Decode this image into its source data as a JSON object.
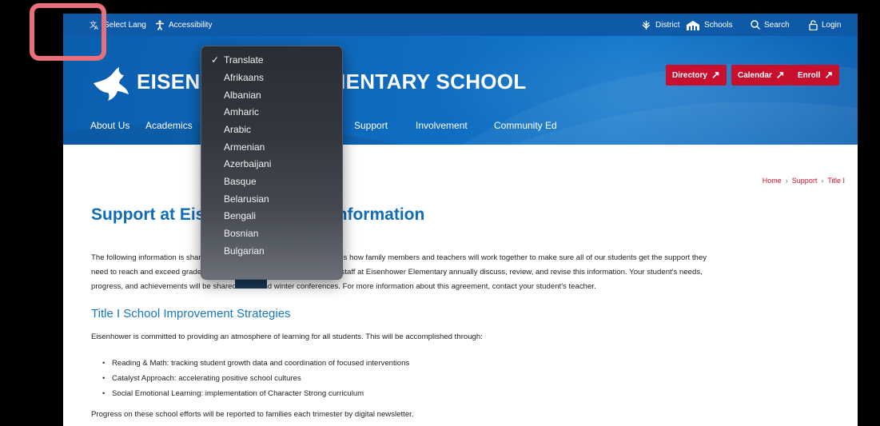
{
  "topbar": {
    "select_lang": "Select Lang",
    "accessibility": "Accessibility",
    "district": "District",
    "schools": "Schools",
    "search": "Search",
    "login": "Login"
  },
  "header": {
    "school_name": "EISENHOWER ELEMENTARY SCHOOL",
    "buttons": [
      "Directory",
      "Calendar",
      "Enroll"
    ],
    "nav": [
      "About Us",
      "Academics",
      "Support",
      "Involvement",
      "Community Ed"
    ]
  },
  "breadcrumb": [
    "Home",
    "Support",
    "Title I"
  ],
  "page_title": "Support at Eisenhower: Title I information",
  "intro_lines": [
    "The following information is shared in a school-family compact that explains how family members and teachers will work together to make sure all of our students get the support they",
    "need to reach and exceed grade-level standards. Families, students, and staff at Eisenhower Elementary annually discuss, review, and revise this information.  Your student's needs,",
    "progress, and achievements will be shared at fall and winter conferences.  For more information about this agreement, contact your student's teacher."
  ],
  "section_heading": "Title I School Improvement Strategies",
  "section_intro": "Eisenhower is committed to providing an atmosphere of learning for all students. This will be accomplished through:",
  "bullets": [
    "Reading & Math: tracking student growth data and coordination of focused interventions",
    "Catalyst Approach: accelerating positive school cultures",
    "Social Emotional Learning: implementation of Character Strong curriculum"
  ],
  "closing": "Progress on these school efforts will be reported to families each trimester by digital newsletter.",
  "language_dropdown": {
    "selected": "Translate",
    "check_mark": "✓",
    "options": [
      "Translate",
      "Afrikaans",
      "Albanian",
      "Amharic",
      "Arabic",
      "Armenian",
      "Azerbaijani",
      "Basque",
      "Belarusian",
      "Bengali",
      "Bosnian",
      "Bulgarian"
    ]
  },
  "colors": {
    "brand_blue": "#0f5aa8",
    "accent_red": "#c8102e",
    "title_blue": "#0f6cb6",
    "highlight_pink": "#e8707a"
  }
}
